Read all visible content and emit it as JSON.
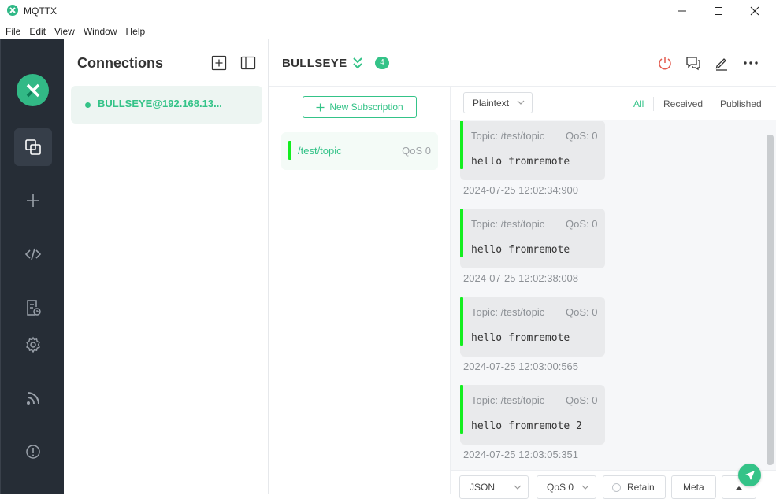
{
  "window": {
    "title": "MQTTX"
  },
  "menu": [
    "File",
    "Edit",
    "View",
    "Window",
    "Help"
  ],
  "connections": {
    "title": "Connections",
    "items": [
      {
        "label": "BULLSEYE@192.168.13...",
        "status": "connected"
      }
    ]
  },
  "header": {
    "title": "BULLSEYE",
    "subscription_count": "4"
  },
  "subscriptions": {
    "new_label": "New Subscription",
    "items": [
      {
        "topic": "/test/topic",
        "qos": "QoS 0"
      }
    ]
  },
  "messages": {
    "format": "Plaintext",
    "filters": [
      "All",
      "Received",
      "Published"
    ],
    "active_filter": "All",
    "items": [
      {
        "topic": "Topic: /test/topic",
        "qos": "QoS: 0",
        "payload": "hello fromremote",
        "time": "2024-07-25 12:02:34:900"
      },
      {
        "topic": "Topic: /test/topic",
        "qos": "QoS: 0",
        "payload": "hello fromremote",
        "time": "2024-07-25 12:02:38:008"
      },
      {
        "topic": "Topic: /test/topic",
        "qos": "QoS: 0",
        "payload": "hello fromremote",
        "time": "2024-07-25 12:03:00:565"
      },
      {
        "topic": "Topic: /test/topic",
        "qos": "QoS: 0",
        "payload": "hello fromremote 2",
        "time": "2024-07-25 12:03:05:351"
      }
    ]
  },
  "publish": {
    "format": "JSON",
    "qos": "QoS 0",
    "retain_label": "Retain",
    "meta_label": "Meta"
  },
  "colors": {
    "accent": "#34c388",
    "nav_bg": "#262d36",
    "message_bar": "#13ee1f"
  }
}
